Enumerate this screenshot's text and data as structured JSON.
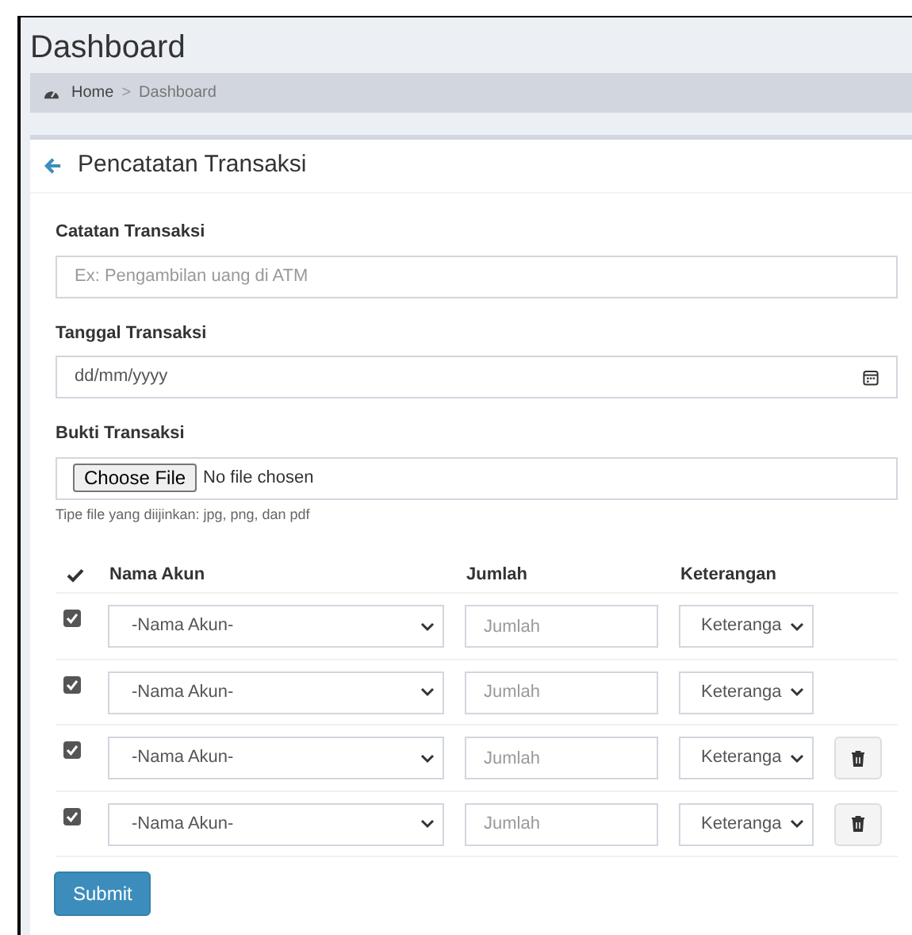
{
  "page_title": "Dashboard",
  "breadcrumb": [
    {
      "label": "Home",
      "kind": "home"
    },
    {
      "label": "Dashboard",
      "kind": "current"
    }
  ],
  "separator": ">",
  "card": {
    "title": "Pencatatan Transaksi",
    "fields": [
      {
        "label": "Catatan Transaksi",
        "kind": "text",
        "placeholder": "Ex: Pengambilan uang di ATM"
      },
      {
        "label": "Tanggal Transaksi",
        "kind": "date",
        "placeholder": "dd/mm/yyyy"
      },
      {
        "label": "Bukti Transaksi",
        "kind": "file",
        "button": "Choose File",
        "value": "No file chosen",
        "help": "Tipe file yang diijinkan: jpg, png, dan pdf"
      }
    ],
    "table": {
      "columns": [
        "Nama Akun",
        "Jumlah",
        "Keterangan"
      ],
      "rows": [
        {
          "checked": true,
          "account": "-Nama Akun-",
          "amount_placeholder": "Jumlah",
          "note": "Keteranga",
          "removable": false
        },
        {
          "checked": true,
          "account": "-Nama Akun-",
          "amount_placeholder": "Jumlah",
          "note": "Keteranga",
          "removable": false
        },
        {
          "checked": true,
          "account": "-Nama Akun-",
          "amount_placeholder": "Jumlah",
          "note": "Keteranga",
          "removable": true
        },
        {
          "checked": true,
          "account": "-Nama Akun-",
          "amount_placeholder": "Jumlah",
          "note": "Keteranga",
          "removable": true
        }
      ]
    },
    "submit": "Submit"
  }
}
